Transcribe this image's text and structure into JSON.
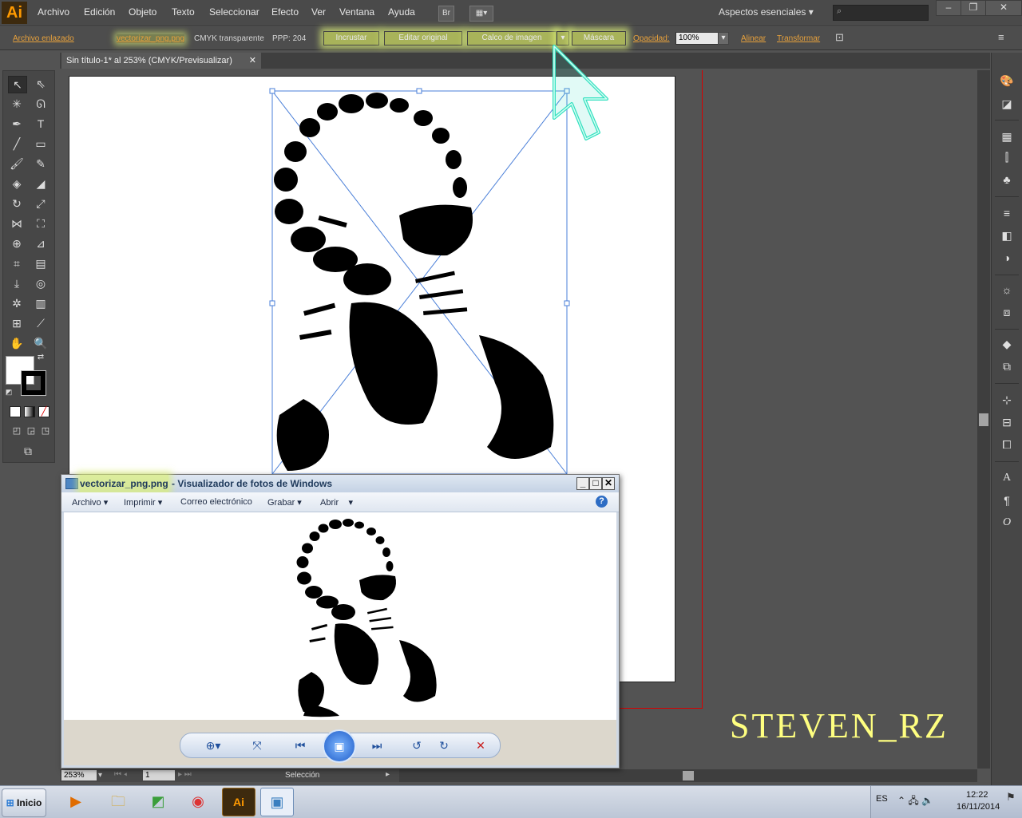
{
  "menubar": {
    "logo": "Ai",
    "items": [
      "Archivo",
      "Edición",
      "Objeto",
      "Texto",
      "Seleccionar",
      "Efecto",
      "Ver",
      "Ventana",
      "Ayuda"
    ],
    "bridge_icon": "Br",
    "workspace": "Aspectos esenciales"
  },
  "controlbar": {
    "linked_file": "Archivo enlazado",
    "filename": "vectorizar_png.png",
    "colormode": "CMYK transparente",
    "ppi": "PPP: 204",
    "embed": "Incrustar",
    "edit_original": "Editar original",
    "image_trace": "Calco de imagen",
    "mask": "Máscara",
    "opacity_label": "Opacidad:",
    "opacity_value": "100%",
    "align": "Alinear",
    "transform": "Transformar"
  },
  "document": {
    "tab_title": "Sin título-1* al 253% (CMYK/Previsualizar)"
  },
  "statusbar": {
    "zoom": "253%",
    "artboard": "1",
    "tool": "Selección"
  },
  "viewer": {
    "filename": "vectorizar_png.png",
    "app_title": " - Visualizador de fotos de Windows",
    "menu": [
      "Archivo",
      "Imprimir",
      "Correo electrónico",
      "Grabar",
      "Abrir"
    ]
  },
  "taskbar": {
    "start": "Inicio",
    "language": "ES",
    "time": "12:22",
    "date": "16/11/2014"
  },
  "watermark": "STEVEN_RZ",
  "colors": {
    "accent_orange": "#e7a13c",
    "highlight": "#dff078",
    "cursor": "#35e0c0",
    "bleed_red": "#d80000"
  }
}
